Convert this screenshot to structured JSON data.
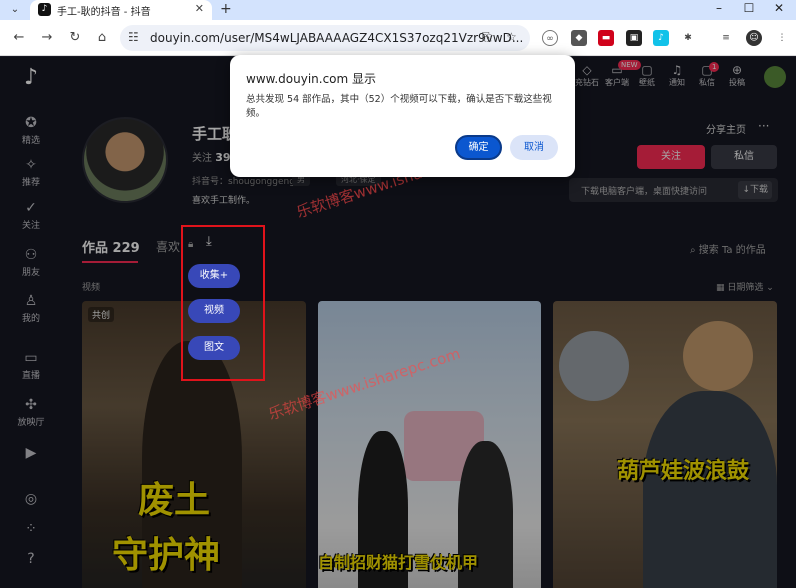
{
  "browser": {
    "tab_title": "手工-耿的抖音 - 抖音",
    "url": "douyin.com/user/MS4wLJABAAAAGZ4CX1S37ozq21Vzr9vwD..."
  },
  "topnav": [
    {
      "label": "充钻石"
    },
    {
      "label": "客户端",
      "badge": "NEW"
    },
    {
      "label": "壁纸"
    },
    {
      "label": "通知"
    },
    {
      "label": "私信",
      "badge": "1"
    },
    {
      "label": "投稿"
    }
  ],
  "sidebar": {
    "items": [
      {
        "label": "精选",
        "icon": "star-icon"
      },
      {
        "label": "推荐",
        "icon": "sparkle-icon"
      },
      {
        "label": "关注",
        "icon": "user-check-icon"
      },
      {
        "label": "朋友",
        "icon": "friends-icon"
      },
      {
        "label": "我的",
        "icon": "person-icon"
      },
      {
        "label": "直播",
        "icon": "live-icon"
      },
      {
        "label": "放映厅",
        "icon": "cinema-icon"
      }
    ]
  },
  "profile": {
    "name": "手工耿",
    "stats_label": "关注",
    "stats_value": "39",
    "id_label": "抖音号：shougonggeng",
    "tags": [
      "男",
      "河北·保定"
    ],
    "bio": "喜欢手工制作。",
    "share_label": "分享主页",
    "more_label": "···",
    "follow_label": "关注",
    "message_label": "私信",
    "client_text": "下载电脑客户端，桌面快捷访问",
    "client_download": "↓下载"
  },
  "works": {
    "tab_label": "作品 229",
    "likes_label": "喜欢",
    "search_label": "搜索 Ta 的作品",
    "section_label": "视频",
    "date_filter": "日期筛选",
    "menu": [
      "收集+",
      "视频",
      "图文"
    ]
  },
  "videos": [
    {
      "tag": "共创",
      "caption_line1": "废土",
      "caption_line2": "守护神"
    },
    {
      "caption_line1": "自制招财猫打雪仗机甲"
    },
    {
      "caption_line1": "葫芦娃波浪鼓"
    }
  ],
  "watermarks": [
    "乐软博客www.isharepc.com",
    "乐软博客www.isharepc.com"
  ],
  "dialog": {
    "title": "www.douyin.com 显示",
    "message": "总共发现 54 部作品，其中（52）个视频可以下载，确认是否下载这些视频。",
    "ok_label": "确定",
    "cancel_label": "取消"
  }
}
